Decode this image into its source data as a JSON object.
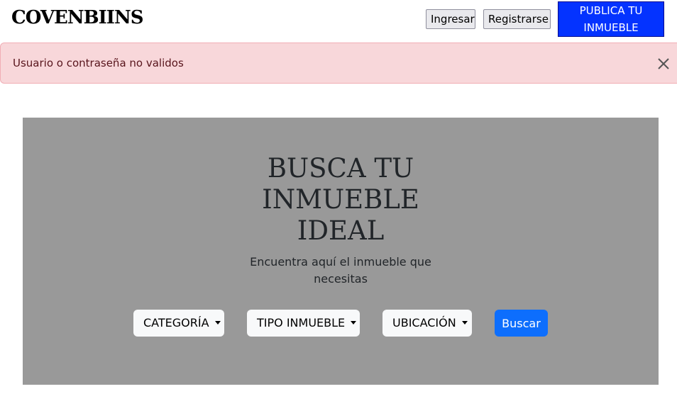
{
  "navbar": {
    "brand": "COVENBIINS",
    "login_label": "Ingresar",
    "register_label": "Registrarse",
    "publish_label": "PUBLICA TU INMUEBLE"
  },
  "alert": {
    "message": "Usuario o contraseña no validos",
    "close_icon": "close-icon"
  },
  "hero": {
    "title_lines": [
      "BUSCA TU",
      "INMUEBLE",
      "IDEAL"
    ],
    "subtitle": "Encuentra aquí el inmueble que necesitas",
    "filters": {
      "category_label": "CATEGORÍA",
      "type_label": "TIPO INMUEBLE",
      "location_label": "UBICACIÓN"
    },
    "search_label": "Buscar"
  },
  "colors": {
    "publish_bg": "#0433ff",
    "alert_bg": "#f8d7da",
    "alert_text": "#58151c",
    "hero_bg": "#999999",
    "search_bg": "#0d6efd"
  }
}
